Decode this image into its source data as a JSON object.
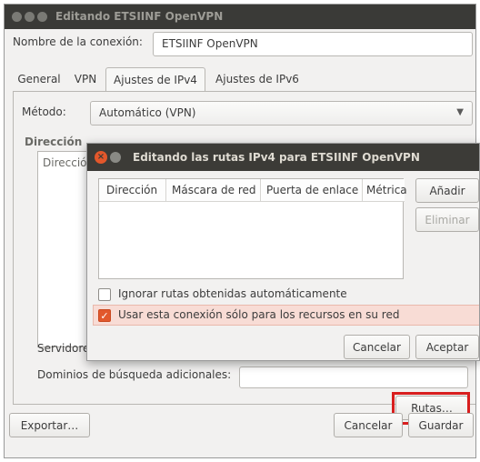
{
  "main_window": {
    "title": "Editando ETSIINF OpenVPN",
    "connection_name_label": "Nombre de la conexión:",
    "connection_name_value": "ETSIINF OpenVPN",
    "tabs": [
      {
        "label": "General",
        "active": false
      },
      {
        "label": "VPN",
        "active": false
      },
      {
        "label": "Ajustes de IPv4",
        "active": true
      },
      {
        "label": "Ajustes de IPv6",
        "active": false
      }
    ],
    "method_label": "Método:",
    "method_value": "Automático (VPN)",
    "addresses_heading": "Dirección",
    "addresses_column": "Direcció",
    "dns_label": "Servidores",
    "search_domains_label": "Dominios de búsqueda adicionales:",
    "routes_button": "Rutas…",
    "export_button": "Exportar…",
    "cancel_button": "Cancelar",
    "save_button": "Guardar"
  },
  "routes_dialog": {
    "title": "Editando las rutas IPv4 para ETSIINF OpenVPN",
    "columns": [
      "Dirección",
      "Máscara de red",
      "Puerta de enlace",
      "Métrica"
    ],
    "rows": [],
    "add_button": "Añadir",
    "remove_button": "Eliminar",
    "ignore_auto_routes_label": "Ignorar rutas obtenidas automáticamente",
    "ignore_auto_routes_checked": false,
    "only_resources_label": "Usar esta conexión sólo para los recursos en su red",
    "only_resources_checked": true,
    "cancel_button": "Cancelar",
    "accept_button": "Aceptar"
  },
  "colors": {
    "titlebar": "#3a3a37",
    "accent": "#e2582c",
    "highlight": "#d81e1e"
  }
}
